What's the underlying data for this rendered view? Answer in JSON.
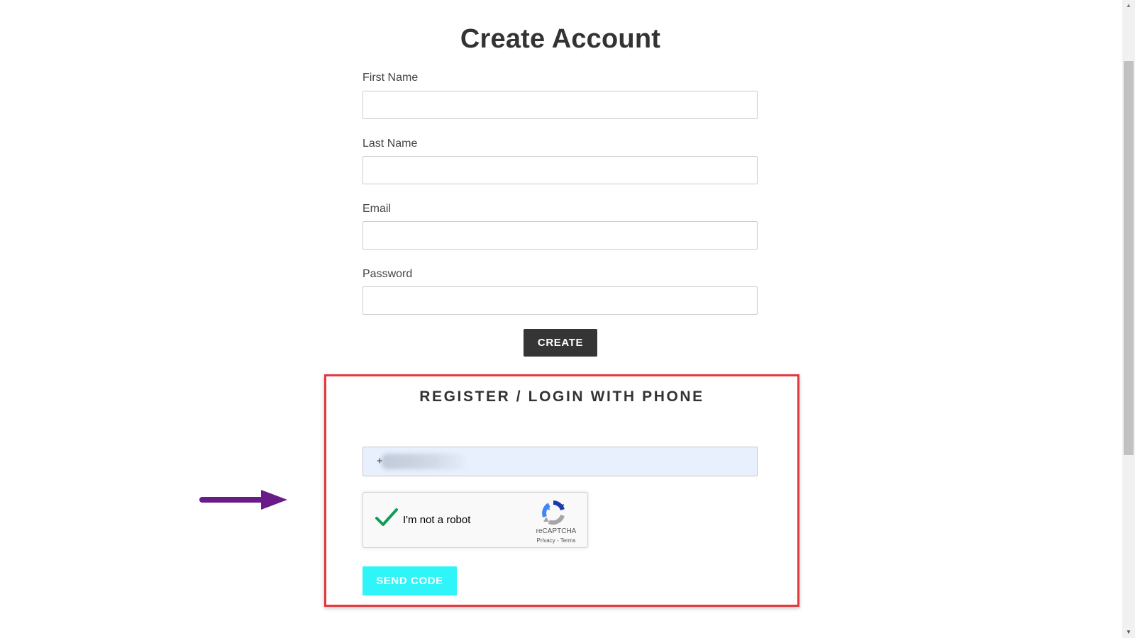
{
  "form": {
    "title": "Create Account",
    "fields": [
      {
        "label": "First Name",
        "value": ""
      },
      {
        "label": "Last Name",
        "value": ""
      },
      {
        "label": "Email",
        "value": ""
      },
      {
        "label": "Password",
        "value": ""
      }
    ],
    "create_label": "CREATE"
  },
  "phone_section": {
    "title": "REGISTER / LOGIN WITH PHONE",
    "phone_prefix": "+",
    "recaptcha": {
      "label": "I'm not a robot",
      "brand": "reCAPTCHA",
      "links": "Privacy - Terms",
      "checked": true
    },
    "send_label": "SEND CODE"
  },
  "colors": {
    "highlight_border": "#e0393e",
    "annotation_arrow": "#6a1b8a",
    "send_button": "#2ff5f8",
    "create_button": "#353535",
    "autofill_background": "#e8f0fe",
    "check_green": "#0f9d58"
  },
  "icons": {
    "check": "check-icon",
    "recaptcha_logo": "recaptcha-logo-icon",
    "arrow": "arrow-right-icon"
  }
}
